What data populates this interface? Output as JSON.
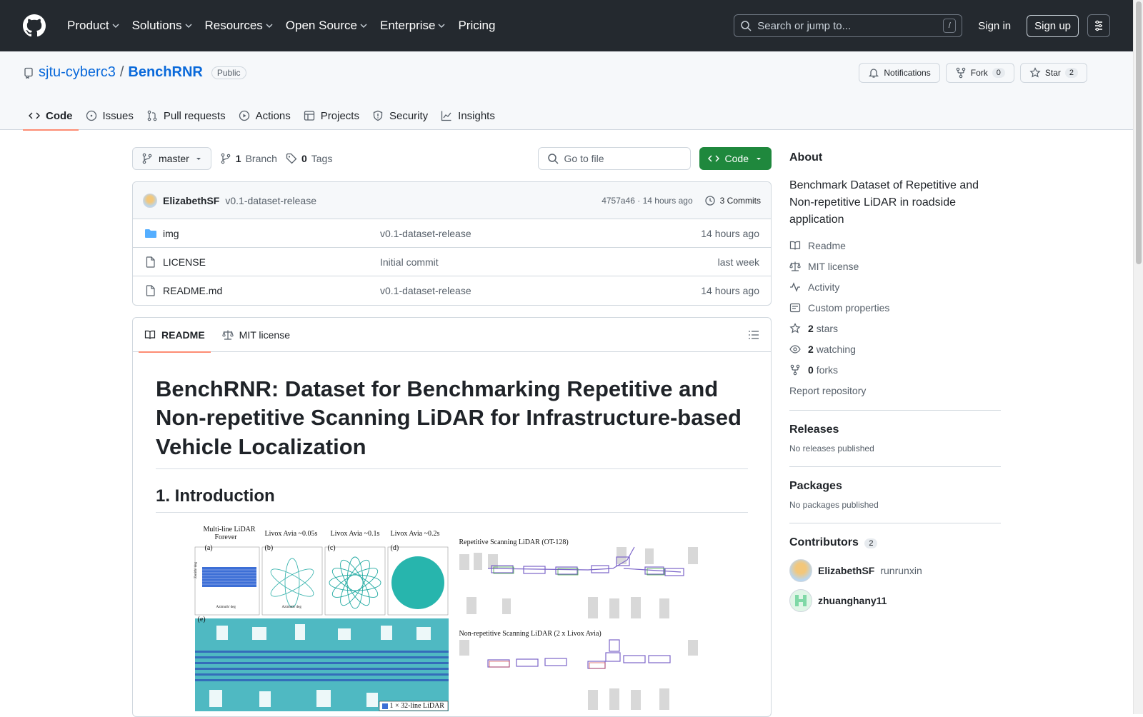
{
  "header": {
    "nav": [
      "Product",
      "Solutions",
      "Resources",
      "Open Source",
      "Enterprise",
      "Pricing"
    ],
    "search_placeholder": "Search or jump to...",
    "search_shortcut": "/",
    "signin": "Sign in",
    "signup": "Sign up"
  },
  "repo": {
    "owner": "sjtu-cyberc3",
    "separator": "/",
    "name": "BenchRNR",
    "visibility": "Public",
    "notifications": "Notifications",
    "fork_label": "Fork",
    "fork_count": "0",
    "star_label": "Star",
    "star_count": "2",
    "tabs": [
      "Code",
      "Issues",
      "Pull requests",
      "Actions",
      "Projects",
      "Security",
      "Insights"
    ]
  },
  "branch": {
    "current": "master",
    "branches_count": "1",
    "branches_label": "Branch",
    "tags_count": "0",
    "tags_label": "Tags",
    "goto_file": "Go to file",
    "code_button": "Code"
  },
  "commit": {
    "author": "ElizabethSF",
    "message": "v0.1-dataset-release",
    "hash": "4757a46",
    "dot": "·",
    "time": "14 hours ago",
    "commits_label": "3 Commits"
  },
  "files": [
    {
      "name": "img",
      "type": "folder",
      "commit": "v0.1-dataset-release",
      "time": "14 hours ago"
    },
    {
      "name": "LICENSE",
      "type": "file",
      "commit": "Initial commit",
      "time": "last week"
    },
    {
      "name": "README.md",
      "type": "file",
      "commit": "v0.1-dataset-release",
      "time": "14 hours ago"
    }
  ],
  "readme": {
    "tab_readme": "README",
    "tab_license": "MIT license",
    "title": "BenchRNR: Dataset for Benchmarking Repetitive and Non-repetitive Scanning LiDAR for Infrastructure-based Vehicle Localization",
    "section1": "1. Introduction",
    "figure": {
      "labels": {
        "multi_line": "Multi-line LiDAR",
        "forever": "Forever",
        "avia005": "Livox Avia ~0.05s",
        "avia01": "Livox Avia ~0.1s",
        "avia02": "Livox Avia ~0.2s",
        "a": "(a)",
        "b": "(b)",
        "c": "(c)",
        "d": "(d)",
        "e": "(e)",
        "azimuth": "Azimuth/ deg",
        "zenith": "Zenith/ deg",
        "repetitive": "Repetitive Scanning LiDAR (OT-128)",
        "non_repetitive": "Non-repetitive Scanning LiDAR (2 x Livox Avia)",
        "legend": "1 × 32-line LiDAR"
      }
    }
  },
  "about": {
    "heading": "About",
    "description": "Benchmark Dataset of Repetitive and Non-repetitive LiDAR in roadside application",
    "readme": "Readme",
    "license": "MIT license",
    "activity": "Activity",
    "custom_properties": "Custom properties",
    "stars_count": "2",
    "stars_label": "stars",
    "watching_count": "2",
    "watching_label": "watching",
    "forks_count": "0",
    "forks_label": "forks",
    "report": "Report repository"
  },
  "releases": {
    "heading": "Releases",
    "empty": "No releases published"
  },
  "packages": {
    "heading": "Packages",
    "empty": "No packages published"
  },
  "contributors": {
    "heading": "Contributors",
    "count": "2",
    "list": [
      {
        "name": "ElizabethSF",
        "alt": "runrunxin"
      },
      {
        "name": "zhuanghany11",
        "alt": ""
      }
    ]
  },
  "colors": {
    "header_bg": "#24292f",
    "link": "#0969da",
    "green_button": "#1f883d",
    "active_tab_underline": "#fd8c73"
  }
}
